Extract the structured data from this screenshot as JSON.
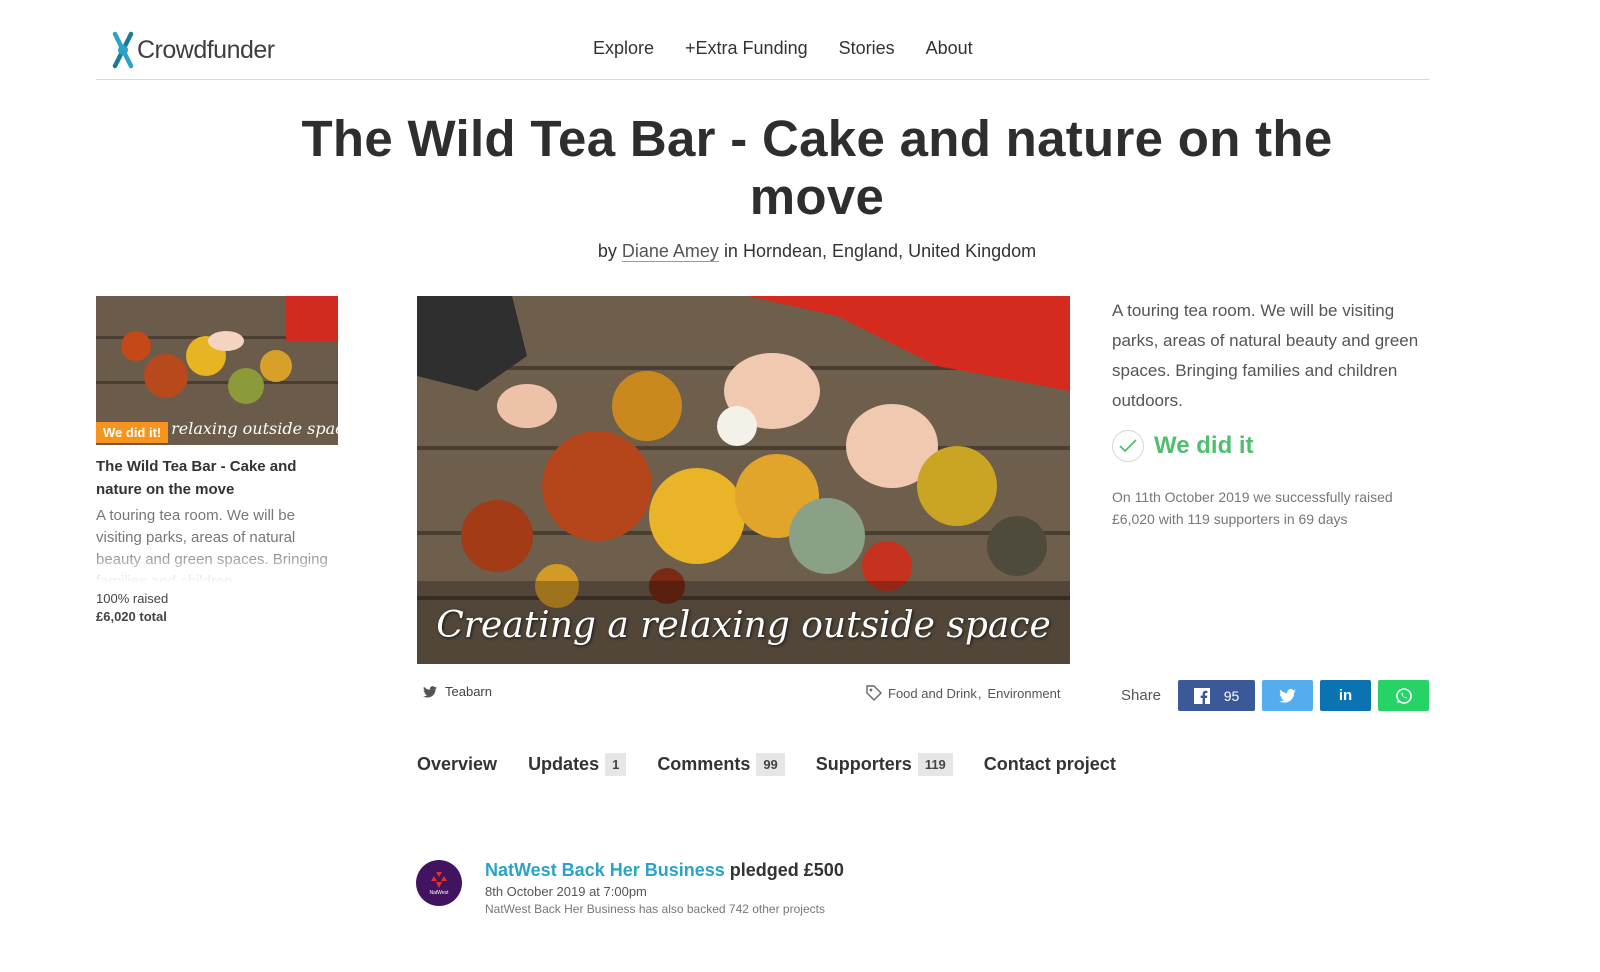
{
  "brand": {
    "name": "Crowdfunder",
    "logo_icon": "crowdfunder-x-icon",
    "accent": "#2aa3c6"
  },
  "nav": {
    "items": [
      "Explore",
      "+Extra Funding",
      "Stories",
      "About"
    ]
  },
  "project": {
    "title": "The Wild Tea Bar - Cake and nature on the move",
    "by_prefix": "by",
    "author": "Diane Amey",
    "location": "in Horndean, England, United Kingdom",
    "hero_caption": "Creating a relaxing outside space",
    "twitter": "Teabarn",
    "tags": [
      "Food and Drink",
      "Environment"
    ]
  },
  "side_card": {
    "badge": "We did it!",
    "title": "The Wild Tea Bar - Cake and nature on the move",
    "description": "A touring tea room. We will be visiting parks, areas of natural beauty and green spaces. Bringing families and children",
    "percent_raised": "100% raised",
    "total": "£6,020 total",
    "thumb_caption": "Creating a relaxing outside space"
  },
  "summary": {
    "text": "A touring tea room. We will be visiting parks, areas of natural beauty and green spaces. Bringing families and children outdoors.",
    "status": "We did it",
    "status_color": "#4fbf6e",
    "raised_text": "On 11th October 2019 we successfully raised £6,020 with 119 supporters in 69 days"
  },
  "share": {
    "label": "Share",
    "facebook_count": "95",
    "colors": {
      "facebook": "#3b5998",
      "twitter": "#55acee",
      "linkedin": "#0b73b1",
      "whatsapp": "#27d367"
    }
  },
  "tabs": [
    {
      "label": "Overview",
      "count": ""
    },
    {
      "label": "Updates",
      "count": "1"
    },
    {
      "label": "Comments",
      "count": "99"
    },
    {
      "label": "Supporters",
      "count": "119"
    },
    {
      "label": "Contact project",
      "count": ""
    }
  ],
  "pledge": {
    "name": "NatWest Back Her Business",
    "action": "pledged £500",
    "date": "8th October 2019 at 7:00pm",
    "note": "NatWest Back Her Business has also backed 742 other projects",
    "avatar_text": "NatWest",
    "avatar_color": "#42145f"
  }
}
